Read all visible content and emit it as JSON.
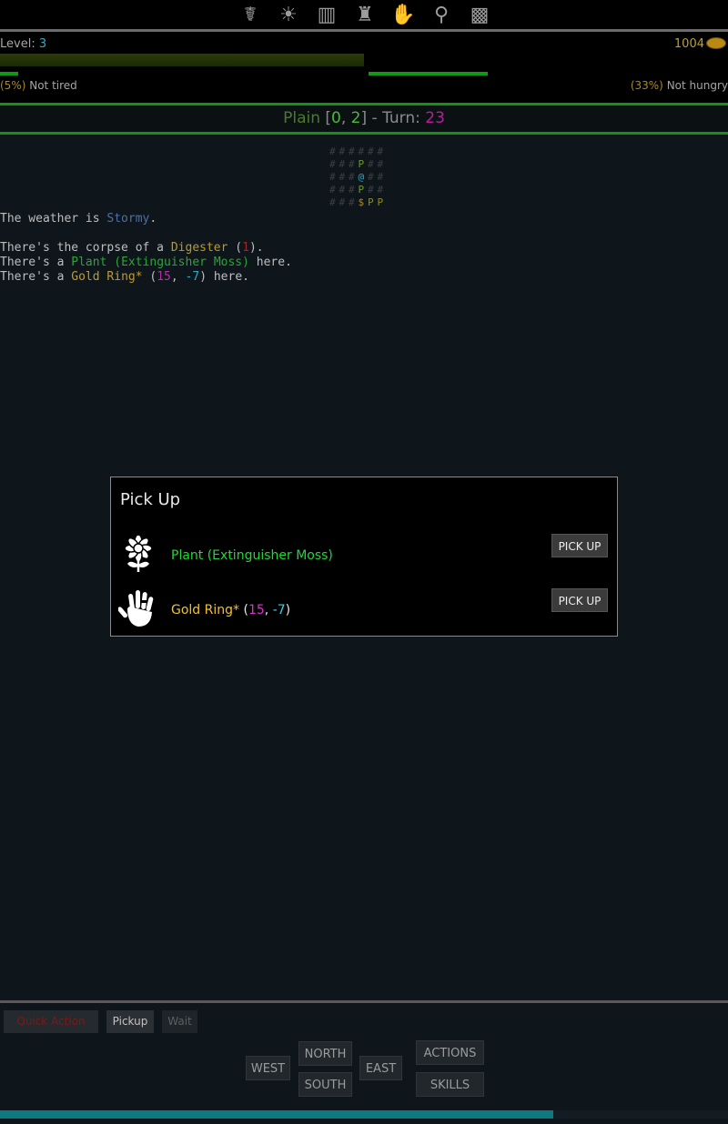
{
  "toolbar": {
    "icons": [
      {
        "name": "character-icon",
        "glyph": "☤"
      },
      {
        "name": "body-icon",
        "glyph": "☀"
      },
      {
        "name": "equipment-icon",
        "glyph": "▥"
      },
      {
        "name": "armor-icon",
        "glyph": "♜"
      },
      {
        "name": "magic-icon",
        "glyph": "✋"
      },
      {
        "name": "look-icon",
        "glyph": "⚲"
      },
      {
        "name": "map-icon",
        "glyph": "▩"
      }
    ]
  },
  "stats": {
    "level_label": "Level:",
    "level_value": "3",
    "gold": "1004",
    "xp_fraction": 0.5,
    "tired_pct": "(5%)",
    "tired_text": "Not tired",
    "hungry_pct": "(33%)",
    "hungry_text": "Not hungry",
    "colors": {
      "bar": "#0f9a15",
      "accent": "#3aa6c4"
    }
  },
  "location": {
    "name": "Plain",
    "x": "0",
    "y": "2",
    "turn_label": "Turn:",
    "turn": "23"
  },
  "map": {
    "rows": [
      [
        {
          "ch": "#",
          "col": "#3c3f44"
        },
        {
          "ch": "#",
          "col": "#3c3f44"
        },
        {
          "ch": "#",
          "col": "#3c3f44"
        },
        {
          "ch": "#",
          "col": "#3c3f44"
        },
        {
          "ch": "#",
          "col": "#3c3f44"
        },
        {
          "ch": "#",
          "col": "#3c3f44"
        }
      ],
      [
        {
          "ch": "#",
          "col": "#3c3f44"
        },
        {
          "ch": "#",
          "col": "#3c3f44"
        },
        {
          "ch": "#",
          "col": "#3c3f44"
        },
        {
          "ch": "P",
          "col": "#6a9a2a"
        },
        {
          "ch": "#",
          "col": "#3c3f44"
        },
        {
          "ch": "#",
          "col": "#3c3f44"
        }
      ],
      [
        {
          "ch": "#",
          "col": "#3c3f44"
        },
        {
          "ch": "#",
          "col": "#3c3f44"
        },
        {
          "ch": "#",
          "col": "#3c3f44"
        },
        {
          "ch": "@",
          "col": "#2ea6c6"
        },
        {
          "ch": "#",
          "col": "#3c3f44"
        },
        {
          "ch": "#",
          "col": "#3c3f44"
        }
      ],
      [
        {
          "ch": "#",
          "col": "#3c3f44"
        },
        {
          "ch": "#",
          "col": "#3c3f44"
        },
        {
          "ch": "#",
          "col": "#3c3f44"
        },
        {
          "ch": "P",
          "col": "#6a9a2a"
        },
        {
          "ch": "#",
          "col": "#3c3f44"
        },
        {
          "ch": "#",
          "col": "#3c3f44"
        }
      ],
      [
        {
          "ch": "#",
          "col": "#3c3f44"
        },
        {
          "ch": "#",
          "col": "#3c3f44"
        },
        {
          "ch": "#",
          "col": "#3c3f44"
        },
        {
          "ch": "$",
          "col": "#b98914"
        },
        {
          "ch": "P",
          "col": "#8f8a22"
        },
        {
          "ch": "P",
          "col": "#8f8a22"
        }
      ]
    ]
  },
  "log": {
    "weather_prefix": "The weather is ",
    "weather": "Stormy",
    "weather_suffix": ".",
    "corpse_prefix": "There's the corpse of a ",
    "corpse_name": "Digester",
    "corpse_count": "1",
    "plant_prefix": "There's a ",
    "plant_name": "Plant (Extinguisher Moss)",
    "plant_suffix": " here.",
    "ring_prefix": "There's a ",
    "ring_name": "Gold Ring*",
    "ring_a": "15",
    "ring_b": "-7",
    "ring_suffix": " here."
  },
  "dialog": {
    "title": "Pick Up",
    "items": [
      {
        "name": "Plant (Extinguisher Moss)",
        "icon": "flower-icon",
        "button": "PICK UP"
      },
      {
        "name": "Gold Ring*",
        "a": "15",
        "b": "-7",
        "icon": "hand-icon",
        "button": "PICK UP"
      }
    ]
  },
  "bottom": {
    "quick": {
      "obscured": "Quick Action",
      "pickup": "Pickup",
      "wait": "Wait"
    },
    "nav": {
      "west": "WEST",
      "north": "NORTH",
      "south": "SOUTH",
      "east": "EAST",
      "actions": "ACTIONS",
      "skills": "SKILLS"
    },
    "progress_fraction": 0.76
  }
}
